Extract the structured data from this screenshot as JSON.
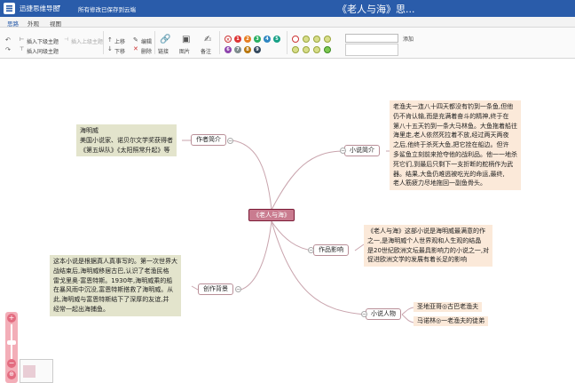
{
  "titlebar": {
    "app_name": "迅捷思维导图",
    "caret": "▾",
    "status": "所有修改已保存到云端",
    "document_title": "《老人与海》思..."
  },
  "menu_tabs": [
    "思路",
    "外观",
    "视图"
  ],
  "toolbar": {
    "undo": "↶",
    "redo": "↷",
    "insert_child": "插入下级主题",
    "insert_parent": "插入上级主题",
    "insert_sibling": "插入同级主题",
    "move_up": "上移",
    "move_down": "下移",
    "edit": "编辑",
    "delete": "删除",
    "link": "链接",
    "image": "图片",
    "note": "备注",
    "tag_add": "添加",
    "priorities": [
      "1",
      "2",
      "3",
      "4",
      "5",
      "6",
      "7",
      "8",
      "9"
    ]
  },
  "mindmap": {
    "root": "《老人与海》",
    "branches": {
      "author": {
        "label": "作者简介",
        "note_lines": [
          "海明威",
          "美国小说家、诺贝尔文学奖获得者",
          "《第五纵队》《太阳照常升起》等"
        ]
      },
      "novel": {
        "label": "小说简介",
        "note_lines": [
          "老渔夫一连八十四天都没有钓到一条鱼,但他",
          "仍不肯认输,而是充满着奋斗的精神,终于在",
          "第八十五天钓到一条大马林鱼。大鱼拖着船往",
          "海里走,老人依然死拉着不放,经过两天两夜",
          "之后,他终于杀死大鱼,把它拴在船边。但许",
          "多鲨鱼立刻前来抢夺他的战利品。他一一地杀",
          "死它们,到最后只剩下一支折断的舵柄作为武",
          "器。结果,大鱼仍难逃被吃光的命运,最终,",
          "老人筋疲力尽地拖回一副鱼骨头。"
        ]
      },
      "influence": {
        "label": "作品影响",
        "note_lines": [
          "《老人与海》这部小说是海明威最满意的作",
          "之一,是海明威个人世界观和人生观的结晶",
          "是20世纪欧洲文坛最具影响力的小说之一,对",
          "促进欧洲文学的发展有着长足的影响"
        ]
      },
      "background": {
        "label": "创作背景",
        "note_lines": [
          "这本小说是根据真人真事写的。第一次世界大",
          "战结束后,海明威移居古巴,认识了老渔民格",
          "雷戈里奥·富恩特斯。1930年,海明威乘的船",
          "在暴风雨中沉没,富恩特斯搭救了海明威。从",
          "此,海明威与富恩特斯结下了深厚的友谊,并",
          "经常一起出海捕鱼。"
        ]
      },
      "characters": {
        "label": "小说人物",
        "items": [
          "圣地亚哥◎古巴老渔夫",
          "马诺林◎一老渔夫的徒弟"
        ]
      }
    }
  },
  "zoom": {
    "plus": "+",
    "minus": "−"
  },
  "colors": {
    "titlebar": "#2a5caa",
    "root_fill": "#c97b8f",
    "root_border": "#7a1a36",
    "link": "#c9a4ad",
    "note_green": "#e3e4cc",
    "note_peach": "#fbe9d9"
  }
}
